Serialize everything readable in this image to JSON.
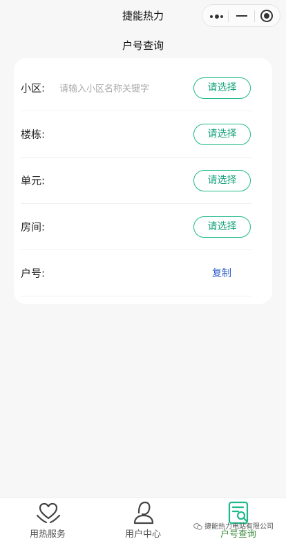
{
  "header": {
    "app_title": "捷能热力"
  },
  "page": {
    "title": "户号查询"
  },
  "form": {
    "rows": [
      {
        "label": "小区:",
        "placeholder": "请输入小区名称关键字",
        "button": "请选择"
      },
      {
        "label": "楼栋:",
        "button": "请选择"
      },
      {
        "label": "单元:",
        "button": "请选择"
      },
      {
        "label": "房间:",
        "button": "请选择"
      },
      {
        "label": "户号:",
        "action": "复制"
      }
    ]
  },
  "tabbar": {
    "items": [
      {
        "label": "用热服务",
        "icon": "heart-hands-icon"
      },
      {
        "label": "用户中心",
        "icon": "user-icon"
      },
      {
        "label": "户号查询",
        "icon": "search-document-icon"
      }
    ]
  },
  "watermark": {
    "text": "捷能热力电站有限公司"
  },
  "colors": {
    "accent": "#1fb88a",
    "link": "#2f5fc6",
    "active_tab": "#3c8a3c"
  }
}
